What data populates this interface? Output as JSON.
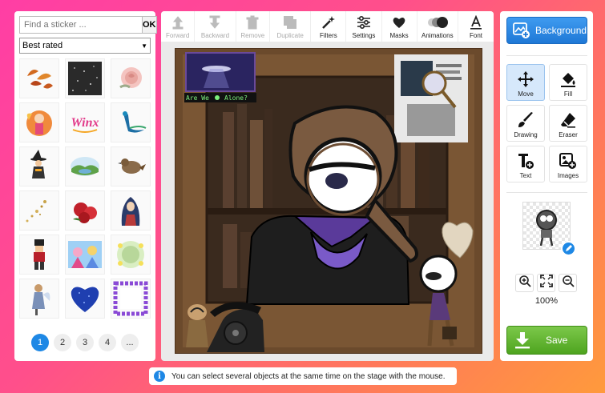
{
  "sticker_panel": {
    "search_placeholder": "Find a sticker ...",
    "ok_label": "OK",
    "sort_selected": "Best rated",
    "stickers": [
      "autumn-leaves-sticker",
      "glitter-texture-sticker",
      "pink-rose-sticker",
      "winx-fairy-sticker",
      "winx-logo-sticker",
      "peacock-sticker",
      "witch-sticker",
      "landscape-oval-sticker",
      "sparrow-bird-sticker",
      "gold-sparkles-sticker",
      "red-roses-sticker",
      "virgin-mary-sticker",
      "nutcracker-sticker",
      "anime-girls-sticker",
      "floral-frame-sticker",
      "fairy-girl-sticker",
      "blue-glitter-heart-sticker",
      "purple-leaf-frame-sticker"
    ],
    "pages": [
      "1",
      "2",
      "3",
      "4",
      "..."
    ],
    "active_page": "1"
  },
  "toolbar": {
    "forward": "Forward",
    "backward": "Backward",
    "remove": "Remove",
    "duplicate": "Duplicate",
    "filters": "Filters",
    "settings": "Settings",
    "masks": "Masks",
    "animations": "Animations",
    "font": "Font"
  },
  "stage": {
    "caption_text": "Are We",
    "caption_text_2": "Alone?"
  },
  "info_bar": {
    "icon": "i",
    "text": "You can select several objects at the same time on the stage with the mouse."
  },
  "right_panel": {
    "background_label": "Background",
    "tools": {
      "move": "Move",
      "fill": "Fill",
      "drawing": "Drawing",
      "eraser": "Eraser",
      "text": "Text",
      "images": "Images"
    },
    "zoom_level": "100%",
    "save_label": "Save"
  },
  "colors": {
    "accent_blue": "#1e88e5",
    "save_green": "#4ea41f",
    "bg_gradient_start": "#ff3ea5",
    "bg_gradient_end": "#ff9a3c"
  }
}
